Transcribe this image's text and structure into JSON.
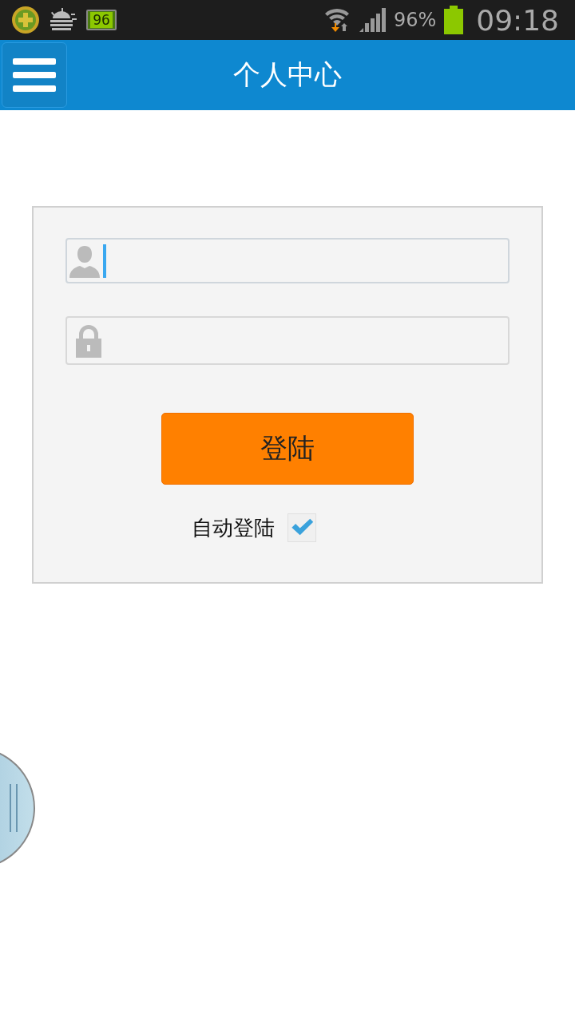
{
  "status_bar": {
    "battery_icon_text": "96",
    "battery_percent": "96%",
    "time": "09:18"
  },
  "app_bar": {
    "title": "个人中心"
  },
  "login_form": {
    "username": {
      "focused": true
    },
    "password": {
      "focused": false
    },
    "login_button": "登陆",
    "auto_login": {
      "label": "自动登陆",
      "checked": true
    }
  }
}
